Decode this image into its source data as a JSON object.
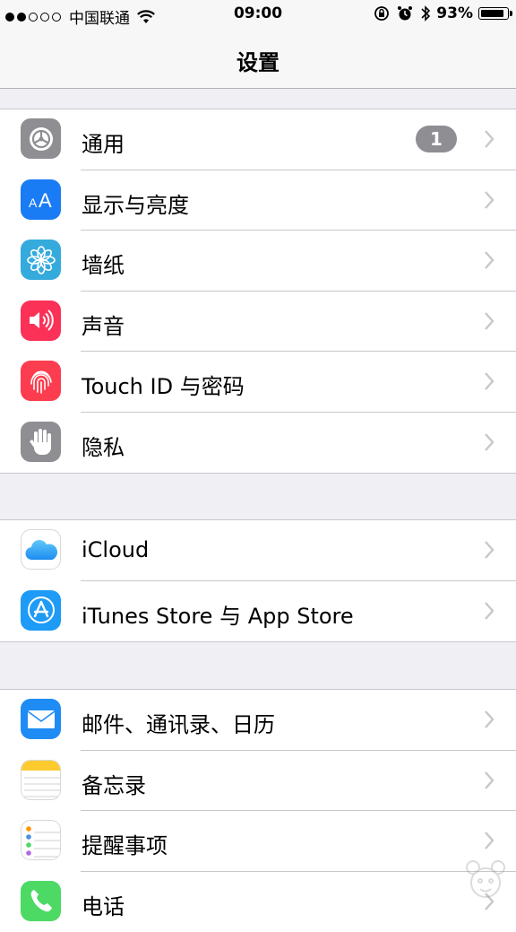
{
  "status_bar": {
    "carrier": "中国联通",
    "time": "09:00",
    "battery": "93%",
    "battery_level": 0.93,
    "signal_bars": 2,
    "signal_total": 5
  },
  "nav": {
    "title": "设置"
  },
  "groups": [
    {
      "items": [
        {
          "label": "通用",
          "icon": "gear-icon",
          "color": "#8e8e93",
          "badge": "1"
        },
        {
          "label": "显示与亮度",
          "icon": "text-size-icon",
          "color": "#1a7cf5"
        },
        {
          "label": "墙纸",
          "icon": "flower-icon",
          "color": "#35aadc"
        },
        {
          "label": "声音",
          "icon": "speaker-icon",
          "color": "#fc3158"
        },
        {
          "label": "Touch ID 与密码",
          "icon": "fingerprint-icon",
          "color": "#fc3d4f"
        },
        {
          "label": "隐私",
          "icon": "hand-icon",
          "color": "#8e8e93"
        }
      ]
    },
    {
      "items": [
        {
          "label": "iCloud",
          "icon": "cloud-icon",
          "color": "#ffffff"
        },
        {
          "label": "iTunes Store 与 App Store",
          "icon": "app-store-icon",
          "color": "#1d9bf6"
        }
      ]
    },
    {
      "items": [
        {
          "label": "邮件、通讯录、日历",
          "icon": "mail-icon",
          "color": "#1f8cf5"
        },
        {
          "label": "备忘录",
          "icon": "notes-icon",
          "color": "#ffffff"
        },
        {
          "label": "提醒事项",
          "icon": "reminders-icon",
          "color": "#ffffff"
        },
        {
          "label": "电话",
          "icon": "phone-icon",
          "color": "#4cd964"
        }
      ]
    }
  ]
}
